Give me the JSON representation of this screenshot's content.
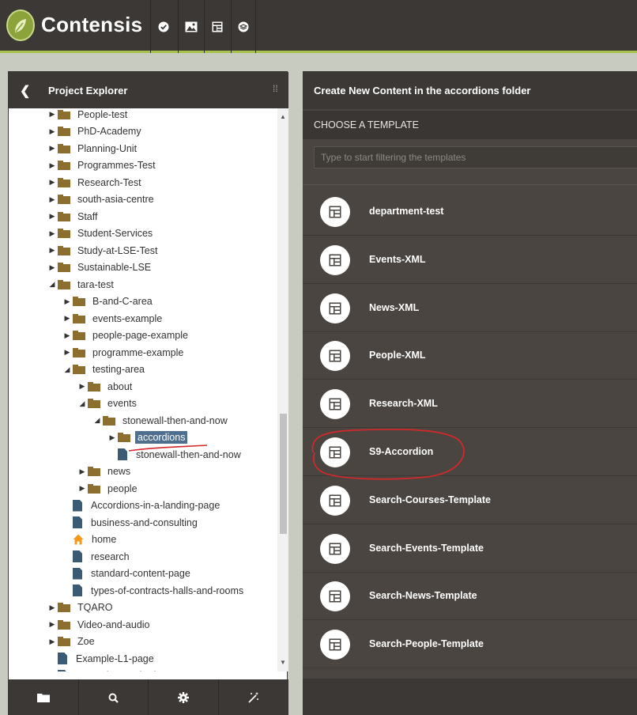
{
  "app": {
    "brand": "Contensis"
  },
  "top_icons": [
    "check-circle-icon",
    "image-icon",
    "template-icon",
    "layers-icon"
  ],
  "left_panel": {
    "title": "Project Explorer",
    "back_glyph": "❮",
    "grip": "⁞⁞",
    "tree": [
      {
        "label": "People-test",
        "type": "folder",
        "depth": 0,
        "arrow": "right"
      },
      {
        "label": "PhD-Academy",
        "type": "folder",
        "depth": 0,
        "arrow": "right"
      },
      {
        "label": "Planning-Unit",
        "type": "folder",
        "depth": 0,
        "arrow": "right"
      },
      {
        "label": "Programmes-Test",
        "type": "folder",
        "depth": 0,
        "arrow": "right"
      },
      {
        "label": "Research-Test",
        "type": "folder",
        "depth": 0,
        "arrow": "right"
      },
      {
        "label": "south-asia-centre",
        "type": "folder",
        "depth": 0,
        "arrow": "right"
      },
      {
        "label": "Staff",
        "type": "folder",
        "depth": 0,
        "arrow": "right"
      },
      {
        "label": "Student-Services",
        "type": "folder",
        "depth": 0,
        "arrow": "right"
      },
      {
        "label": "Study-at-LSE-Test",
        "type": "folder",
        "depth": 0,
        "arrow": "right"
      },
      {
        "label": "Sustainable-LSE",
        "type": "folder",
        "depth": 0,
        "arrow": "right"
      },
      {
        "label": "tara-test",
        "type": "folder",
        "depth": 0,
        "arrow": "down"
      },
      {
        "label": "B-and-C-area",
        "type": "folder",
        "depth": 1,
        "arrow": "right"
      },
      {
        "label": "events-example",
        "type": "folder",
        "depth": 1,
        "arrow": "right"
      },
      {
        "label": "people-page-example",
        "type": "folder",
        "depth": 1,
        "arrow": "right"
      },
      {
        "label": "programme-example",
        "type": "folder",
        "depth": 1,
        "arrow": "right"
      },
      {
        "label": "testing-area",
        "type": "folder",
        "depth": 1,
        "arrow": "down"
      },
      {
        "label": "about",
        "type": "folder",
        "depth": 2,
        "arrow": "right"
      },
      {
        "label": "events",
        "type": "folder",
        "depth": 2,
        "arrow": "down"
      },
      {
        "label": "stonewall-then-and-now",
        "type": "folder",
        "depth": 3,
        "arrow": "down"
      },
      {
        "label": "accordions",
        "type": "folder",
        "depth": 4,
        "arrow": "right",
        "selected": true
      },
      {
        "label": "stonewall-then-and-now",
        "type": "page",
        "depth": 4,
        "arrow": ""
      },
      {
        "label": "news",
        "type": "folder",
        "depth": 2,
        "arrow": "right"
      },
      {
        "label": "people",
        "type": "folder",
        "depth": 2,
        "arrow": "right"
      },
      {
        "label": "Accordions-in-a-landing-page",
        "type": "page-edit",
        "depth": 1,
        "arrow": ""
      },
      {
        "label": "business-and-consulting",
        "type": "page-edit",
        "depth": 1,
        "arrow": ""
      },
      {
        "label": "home",
        "type": "home",
        "depth": 1,
        "arrow": ""
      },
      {
        "label": "research",
        "type": "page",
        "depth": 1,
        "arrow": ""
      },
      {
        "label": "standard-content-page",
        "type": "page",
        "depth": 1,
        "arrow": ""
      },
      {
        "label": "types-of-contracts-halls-and-rooms",
        "type": "page",
        "depth": 1,
        "arrow": ""
      },
      {
        "label": "TQARO",
        "type": "folder",
        "depth": 0,
        "arrow": "right"
      },
      {
        "label": "Video-and-audio",
        "type": "folder",
        "depth": 0,
        "arrow": "right"
      },
      {
        "label": "Zoe",
        "type": "folder",
        "depth": 0,
        "arrow": "right"
      },
      {
        "label": "Example-L1-page",
        "type": "page",
        "depth": 0,
        "arrow": ""
      },
      {
        "label": "Example-standard-content-page",
        "type": "page",
        "depth": 0,
        "arrow": ""
      }
    ],
    "footer_icons": [
      "folder-icon",
      "search-icon",
      "gear-icon",
      "magic-wand-icon"
    ]
  },
  "right_panel": {
    "title": "Create New Content in the accordions folder",
    "section": "CHOOSE A TEMPLATE",
    "filter_placeholder": "Type to start filtering the templates",
    "templates": [
      "department-test",
      "Events-XML",
      "News-XML",
      "People-XML",
      "Research-XML",
      "S9-Accordion",
      "Search-Courses-Template",
      "Search-Events-Template",
      "Search-News-Template",
      "Search-People-Template"
    ]
  },
  "colors": {
    "accent_green": "#a6c24a",
    "dark_bar": "#3c3835",
    "panel_dark": "#4a4541",
    "folder": "#8c6e2e",
    "page_icon": "#3b5a74",
    "selection": "#4f6f8f",
    "annotation": "#d6282a"
  }
}
